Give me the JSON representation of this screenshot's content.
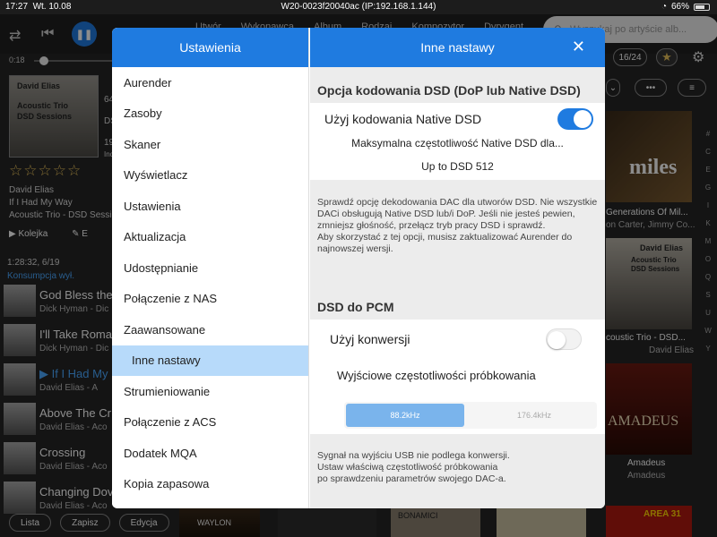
{
  "status": {
    "time": "17:27",
    "date": "Wt. 10.08",
    "device": "W20-0023f20040ac (IP:192.168.1.144)",
    "battery": "66%"
  },
  "player": {
    "position": "0:18",
    "play_icon": "pause-icon"
  },
  "nav": {
    "tabs": [
      "Utwór",
      "Wykonawca",
      "Album",
      "Rodzaj",
      "Kompozytor",
      "Dyrygent"
    ],
    "search_placeholder": "Wyszukaj po artyście alb..."
  },
  "now_playing": {
    "cover_title": "David Elias",
    "cover_line1": "Acoustic Trio",
    "cover_line2": "DSD Sessions",
    "partial1": "64",
    "partial2": "DS",
    "partial3": "19",
    "partial4": "DS",
    "partial5": "Inc",
    "rating": "☆☆☆☆☆",
    "artist": "David Elias",
    "title": "If I Had My Way",
    "album": "Acoustic Trio - DSD Sessi"
  },
  "left_tabs": {
    "queue": "Kolejka",
    "edit": "E"
  },
  "queue": {
    "duration": "1:28:32, 6/19",
    "consumption": "Konsumpcja wył.",
    "tracks": [
      {
        "title": "God Bless the",
        "sub": "Dick Hyman - Dic"
      },
      {
        "title": "I'll Take Roma",
        "sub": "Dick Hyman - Dic"
      },
      {
        "title": "If I Had My",
        "sub": "David Elias - A"
      },
      {
        "title": "Above The Cr",
        "sub": "David Elias - Aco"
      },
      {
        "title": "Crossing",
        "sub": "David Elias - Aco"
      },
      {
        "title": "Changing Dov",
        "sub": "David Elias - Aco"
      }
    ]
  },
  "bottom_buttons": {
    "list": "Lista",
    "save": "Zapisz",
    "edit": "Edycja"
  },
  "right_panel": {
    "counter": "16/24",
    "albums": [
      {
        "title": "Generations Of Mil...",
        "sub": "on Carter, Jimmy Co..."
      },
      {
        "title": "coustic Trio - DSD...",
        "sub": "David Elias"
      },
      {
        "title": "Amadeus",
        "sub": "Amadeus"
      }
    ],
    "cover2_title": "David Elias",
    "cover2_sub": "Acoustic Trio DSD Sessions",
    "cover1_label": "miles",
    "cover3_label": "AMADEUS",
    "bottom_label1": "WAYLON",
    "bottom_label2": "BONAMICI",
    "bottom_label3": "AREA 31"
  },
  "alphabet": [
    "#",
    "C",
    "E",
    "G",
    "I",
    "K",
    "M",
    "O",
    "Q",
    "S",
    "U",
    "W",
    "Y"
  ],
  "modal": {
    "left_title": "Ustawienia",
    "menu": [
      "Aurender",
      "Zasoby",
      "Skaner",
      "Wyświetlacz",
      "Ustawienia",
      "Aktualizacja",
      "Udostępnianie",
      "Połączenie z NAS",
      "Zaawansowane",
      "Inne nastawy",
      "Strumieniowanie",
      "Połączenie z ACS",
      "Dodatek MQA",
      "Kopia zapasowa"
    ],
    "right_title": "Inne nastawy",
    "dsd_section": "Opcja kodowania DSD (DoP lub Native DSD)",
    "native_label": "Użyj kodowania Native DSD",
    "native_on": true,
    "max_freq_label": "Maksymalna częstotliwość Native DSD dla...",
    "max_freq_value": "Up to DSD 512",
    "dsd_note": "Sprawdź opcję dekodowania DAC dla utworów DSD. Nie wszystkie DACi obsługują Native DSD lub/i DoP. Jeśli nie jesteś pewien, zmniejsz głośność, przełącz tryb pracy DSD i sprawdź.\nAby skorzystać z tej opcji, musisz zaktualizować Aurender do najnowszej wersji.",
    "pcm_section": "DSD do PCM",
    "convert_label": "Użyj konwersji",
    "convert_on": false,
    "rate_label": "Wyjściowe częstotliwości próbkowania",
    "rate_options": [
      "88.2kHz",
      "176.4kHz"
    ],
    "rate_selected": "88.2kHz",
    "pcm_note": "Sygnał na wyjściu USB nie podlega konwersji.\nUstaw właściwą częstotliwość próbkowania\npo sprawdzeniu parametrów swojego DAC-a."
  },
  "colors": {
    "accent": "#1f7be0",
    "selected_row": "#b7dafa",
    "active_track": "#4aa8ff",
    "star": "#e8c15a"
  }
}
